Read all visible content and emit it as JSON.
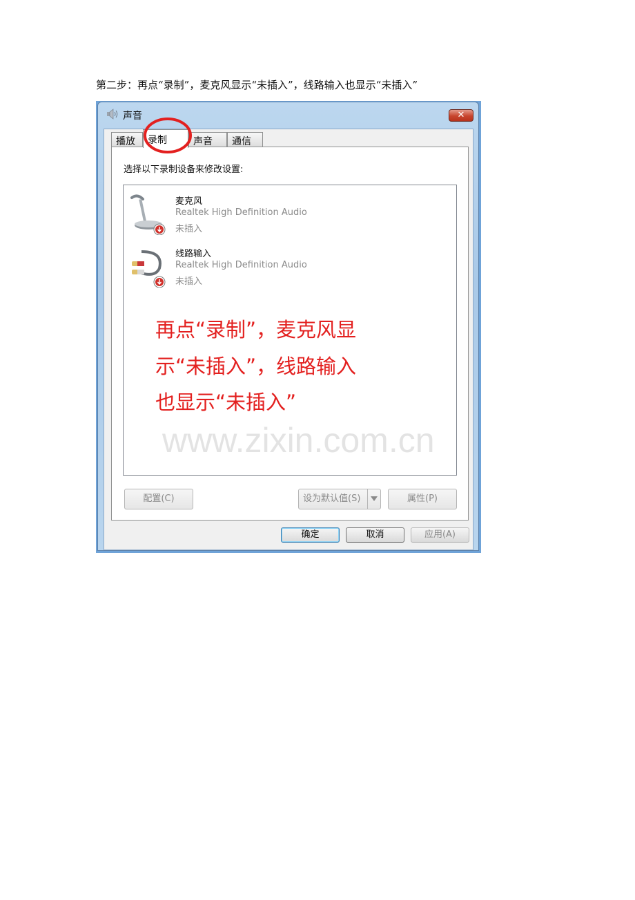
{
  "doc": {
    "step_text": "第二步：再点“录制”，麦克风显示“未插入”，线路输入也显示“未插入”"
  },
  "window": {
    "title": "声音",
    "close_symbol": "✕",
    "tabs": [
      {
        "label": "播放",
        "active": false
      },
      {
        "label": "录制",
        "active": true
      },
      {
        "label": "声音",
        "active": false
      },
      {
        "label": "通信",
        "active": false
      }
    ],
    "panel_label": "选择以下录制设备来修改设置:",
    "devices": [
      {
        "name": "麦克风",
        "driver": "Realtek High Definition Audio",
        "status": "未插入",
        "icon": "microphone-icon"
      },
      {
        "name": "线路输入",
        "driver": "Realtek High Definition Audio",
        "status": "未插入",
        "icon": "line-in-cable-icon"
      }
    ],
    "annotation": {
      "line1": "再点“录制”，麦克风显",
      "line2": "示“未插入”，线路输入",
      "line3": "也显示“未插入”",
      "color": "#e3201f"
    },
    "watermark": "www.zixin.com.cn",
    "buttons": {
      "configure": "配置(C)",
      "set_default": "设为默认值(S)",
      "properties": "属性(P)",
      "ok": "确定",
      "cancel": "取消",
      "apply": "应用(A)"
    }
  }
}
